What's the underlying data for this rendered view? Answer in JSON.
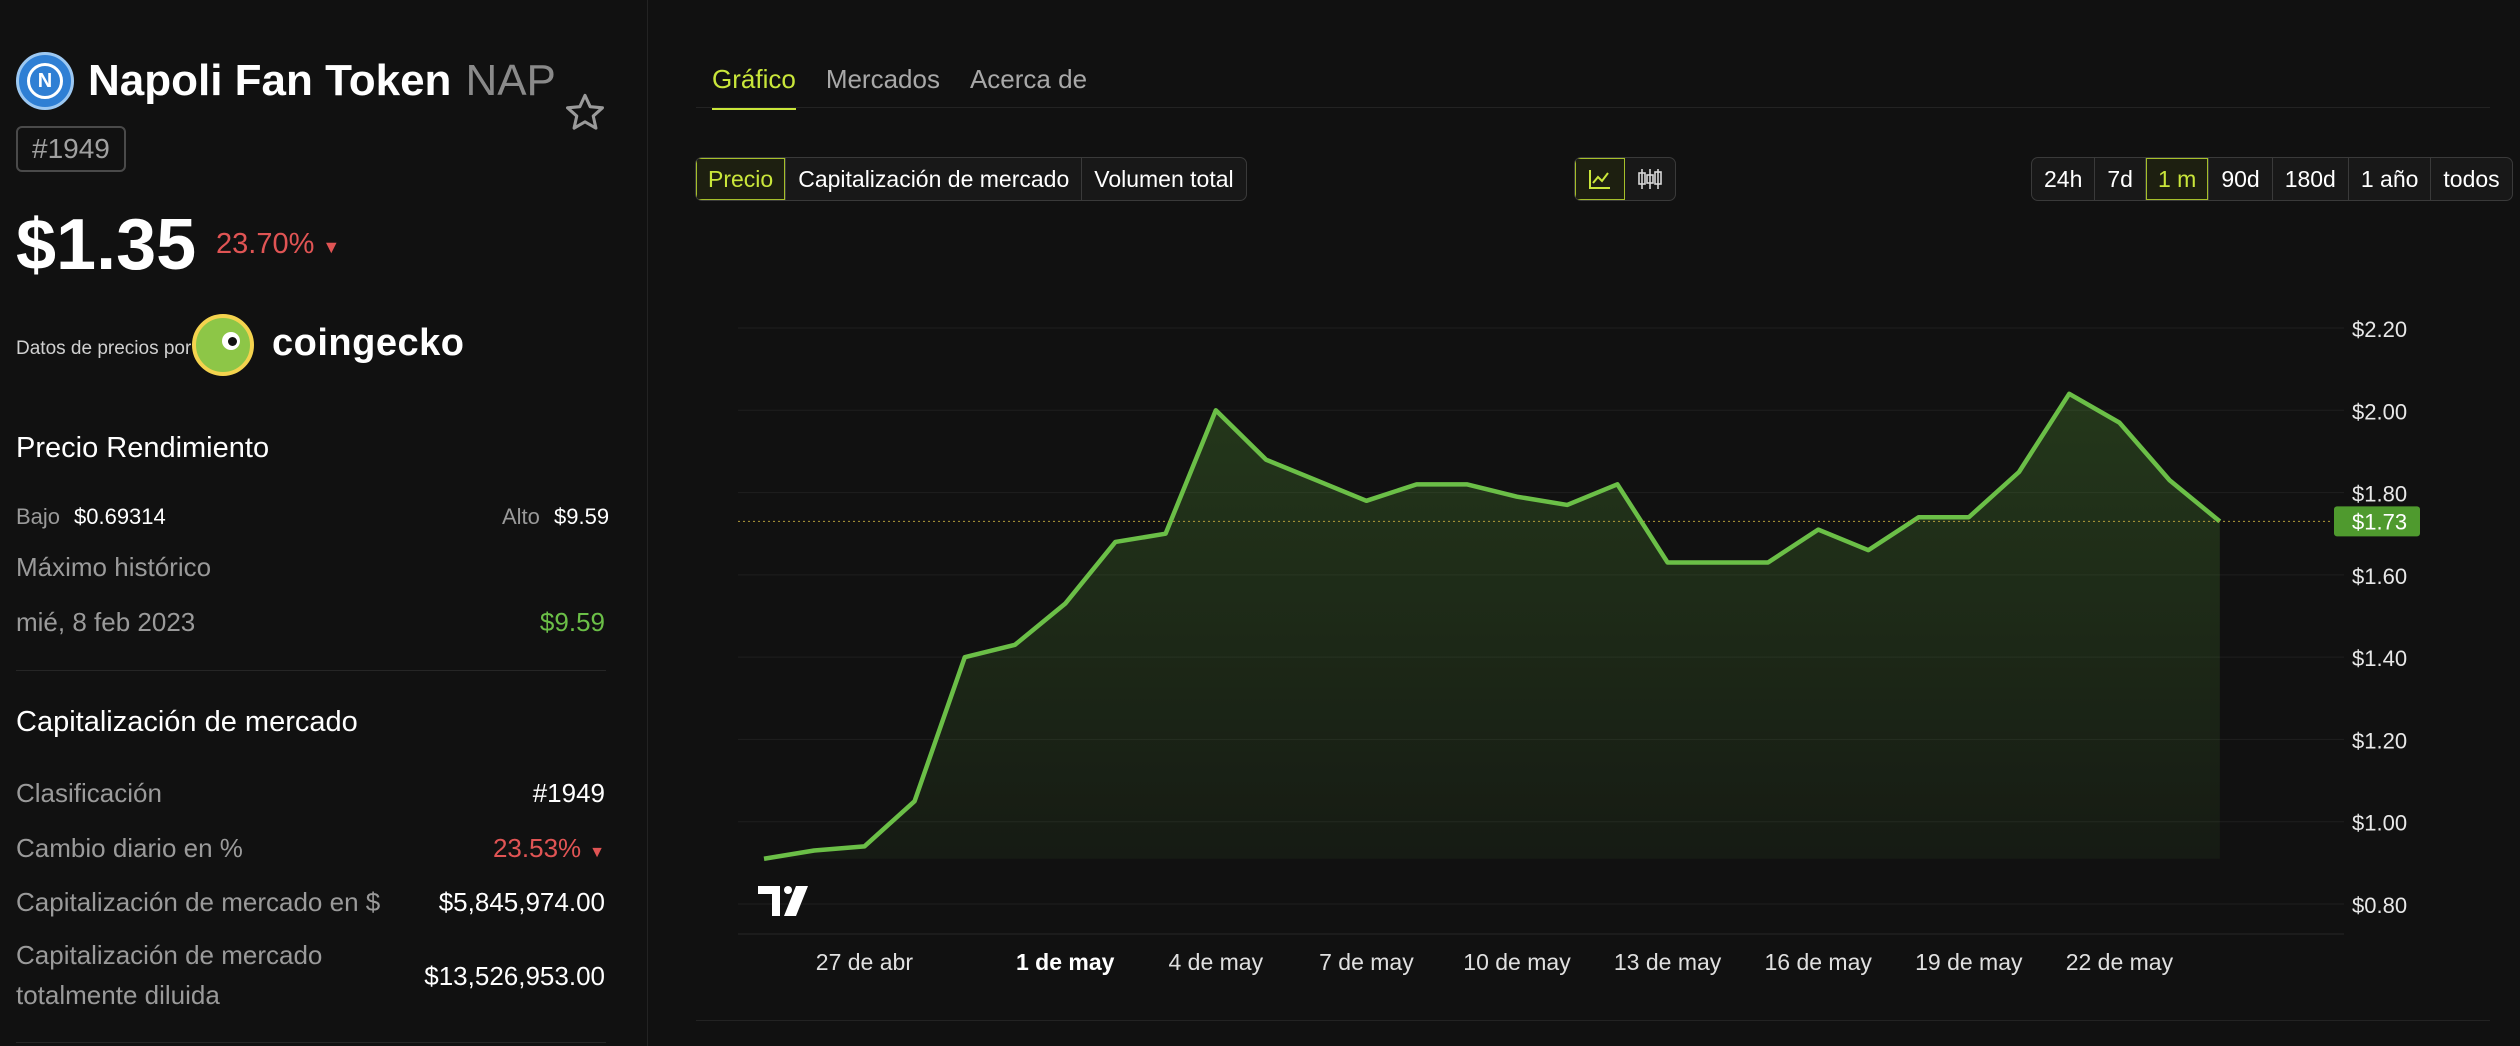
{
  "token": {
    "name": "Napoli Fan Token",
    "symbol": "NAP",
    "logo_letter": "N",
    "rank_badge": "#1949",
    "price": "$1.35",
    "change": "23.70%",
    "change_arrow": "▼"
  },
  "attribution": {
    "label": "Datos de precios por",
    "brand": "coingecko"
  },
  "performance": {
    "title": "Precio Rendimiento",
    "low_label": "Bajo",
    "low_value": "$0.69314",
    "high_label": "Alto",
    "high_value": "$9.59",
    "ath_label": "Máximo histórico",
    "ath_date": "mié, 8 feb 2023",
    "ath_value": "$9.59"
  },
  "market_cap": {
    "title": "Capitalización de mercado",
    "rows": [
      {
        "label": "Clasificación",
        "value": "#1949"
      },
      {
        "label": "Cambio diario en %",
        "value": "23.53%",
        "arrow": "▼"
      },
      {
        "label": "Capitalización de mercado en $",
        "value": "$5,845,974.00"
      },
      {
        "label": "Capitalización de mercado",
        "label2": "totalmente diluida",
        "value": "$13,526,953.00"
      }
    ]
  },
  "tabs": [
    "Gráfico",
    "Mercados",
    "Acerca de"
  ],
  "metric_options": [
    "Precio",
    "Capitalización de mercado",
    "Volumen total"
  ],
  "range_options": [
    "24h",
    "7d",
    "1 m",
    "90d",
    "180d",
    "1 año",
    "todos"
  ],
  "chart_icons": [
    "line-chart-icon",
    "candlestick-icon"
  ],
  "colors": {
    "accent": "#c9e63a",
    "line": "#6bbf47",
    "negative": "#e05454",
    "positive": "#6bbf47",
    "background": "#111111"
  },
  "chart_data": {
    "type": "area",
    "x_tick_labels": [
      "de abr",
      "27 de abr",
      "1 de may",
      "4 de may",
      "7 de may",
      "10 de may",
      "13 de may",
      "16 de may",
      "19 de may",
      "22 de may"
    ],
    "y_tick_labels": [
      "$2.20",
      "$2.00",
      "$1.80",
      "$1.60",
      "$1.40",
      "$1.20",
      "$1.00",
      "$0.80"
    ],
    "y_ticks": [
      2.2,
      2.0,
      1.8,
      1.6,
      1.4,
      1.2,
      1.0,
      0.8
    ],
    "ylim": [
      0.7,
      2.35
    ],
    "current_price_label": "$1.73",
    "current_price": 1.73,
    "series": [
      {
        "x": [
          "2024-04-25",
          "2024-04-26",
          "2024-04-27",
          "2024-04-28",
          "2024-04-29",
          "2024-04-30",
          "2024-05-01",
          "2024-05-02",
          "2024-05-03",
          "2024-05-04",
          "2024-05-05",
          "2024-05-06",
          "2024-05-07",
          "2024-05-08",
          "2024-05-09",
          "2024-05-10",
          "2024-05-11",
          "2024-05-12",
          "2024-05-13",
          "2024-05-14",
          "2024-05-15",
          "2024-05-16",
          "2024-05-17",
          "2024-05-18",
          "2024-05-19",
          "2024-05-20",
          "2024-05-21",
          "2024-05-22",
          "2024-05-23",
          "2024-05-24"
        ],
        "values": [
          0.91,
          0.93,
          0.94,
          1.05,
          1.4,
          1.43,
          1.53,
          1.68,
          1.7,
          2.0,
          1.88,
          1.83,
          1.78,
          1.82,
          1.82,
          1.79,
          1.77,
          1.82,
          1.63,
          1.63,
          1.63,
          1.71,
          1.66,
          1.74,
          1.74,
          1.85,
          2.04,
          1.97,
          1.83,
          1.73
        ]
      }
    ],
    "grid": true,
    "watermark": "TV"
  }
}
